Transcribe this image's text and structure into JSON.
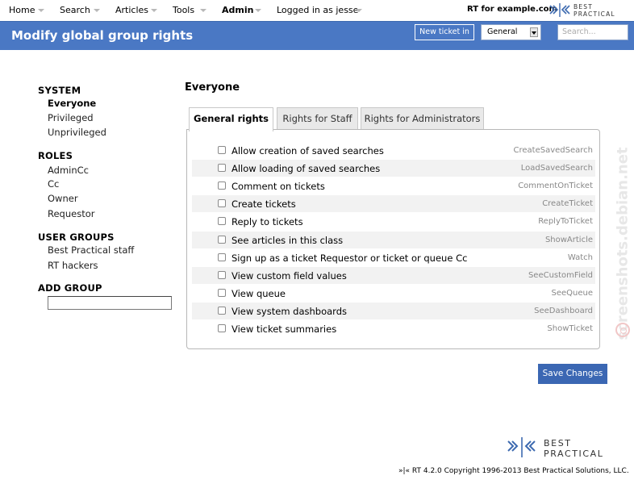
{
  "nav": {
    "items": [
      {
        "label": "Home"
      },
      {
        "label": "Search"
      },
      {
        "label": "Articles"
      },
      {
        "label": "Tools"
      },
      {
        "label": "Admin"
      },
      {
        "label": "Logged in as jesse"
      }
    ],
    "rt_for": "RT for example.com"
  },
  "logo": {
    "line1": "BEST",
    "line2": "PRACTICAL"
  },
  "header": {
    "title": "Modify global group rights",
    "new_ticket_label": "New ticket in",
    "queue_value": "General",
    "search_placeholder": "Search..."
  },
  "sidebar": {
    "system_heading": "SYSTEM",
    "system_items": [
      {
        "label": "Everyone"
      },
      {
        "label": "Privileged"
      },
      {
        "label": "Unprivileged"
      }
    ],
    "roles_heading": "ROLES",
    "role_items": [
      {
        "label": "AdminCc"
      },
      {
        "label": "Cc"
      },
      {
        "label": "Owner"
      },
      {
        "label": "Requestor"
      }
    ],
    "user_groups_heading": "USER GROUPS",
    "user_group_items": [
      {
        "label": "Best Practical staff"
      },
      {
        "label": "RT hackers"
      }
    ],
    "add_group_heading": "ADD GROUP"
  },
  "main": {
    "group_name": "Everyone",
    "tabs": [
      {
        "label": "General rights"
      },
      {
        "label": "Rights for Staff"
      },
      {
        "label": "Rights for Administrators"
      }
    ],
    "rights": [
      {
        "label": "Allow creation of saved searches",
        "code": "CreateSavedSearch",
        "checked": false
      },
      {
        "label": "Allow loading of saved searches",
        "code": "LoadSavedSearch",
        "checked": false
      },
      {
        "label": "Comment on tickets",
        "code": "CommentOnTicket",
        "checked": false
      },
      {
        "label": "Create tickets",
        "code": "CreateTicket",
        "checked": false
      },
      {
        "label": "Reply to tickets",
        "code": "ReplyToTicket",
        "checked": false
      },
      {
        "label": "See articles in this class",
        "code": "ShowArticle",
        "checked": false
      },
      {
        "label": "Sign up as a ticket Requestor or ticket or queue Cc",
        "code": "Watch",
        "checked": false
      },
      {
        "label": "View custom field values",
        "code": "SeeCustomField",
        "checked": false
      },
      {
        "label": "View queue",
        "code": "SeeQueue",
        "checked": false
      },
      {
        "label": "View system dashboards",
        "code": "SeeDashboard",
        "checked": false
      },
      {
        "label": "View ticket summaries",
        "code": "ShowTicket",
        "checked": false
      }
    ],
    "save_label": "Save Changes"
  },
  "watermark": "screenshots.debian.net",
  "footer": {
    "copyright": "»|« RT 4.2.0 Copyright 1996-2013 Best Practical Solutions, LLC."
  },
  "colors": {
    "header_bg": "#4a78c4",
    "button_bg": "#3b67b3",
    "logo_blue": "#3d6ab0"
  }
}
